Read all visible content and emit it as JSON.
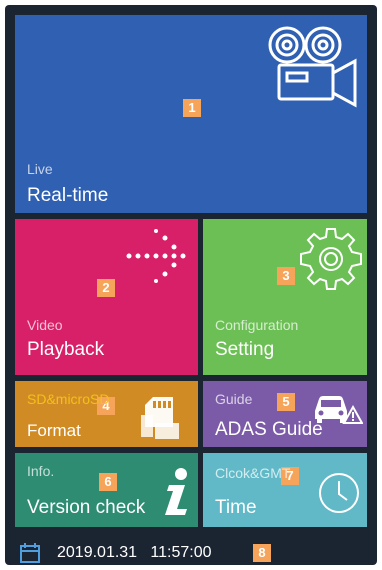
{
  "tiles": {
    "live": {
      "number": "1",
      "subtitle": "Live",
      "title": "Real-time",
      "icon": "video-camera-icon",
      "color": "#3060b2"
    },
    "playback": {
      "number": "2",
      "subtitle": "Video",
      "title": "Playback",
      "icon": "dotted-arrow-icon",
      "color": "#d72068"
    },
    "setting": {
      "number": "3",
      "subtitle": "Configuration",
      "title": "Setting",
      "icon": "gear-icon",
      "color": "#6cbf55"
    },
    "format": {
      "number": "4",
      "subtitle": "SD&microSD",
      "title": "Format",
      "icon": "sd-card-icon",
      "color": "#d18b24"
    },
    "adas": {
      "number": "5",
      "subtitle": "Guide",
      "title": "ADAS Guide",
      "icon": "car-warning-icon",
      "color": "#7b5ba8"
    },
    "version": {
      "number": "6",
      "subtitle": "Info.",
      "title": "Version check",
      "icon": "info-icon",
      "color": "#2e8c73"
    },
    "time": {
      "number": "7",
      "subtitle": "Clcok&GMT",
      "title": "Time",
      "icon": "clock-icon",
      "color": "#61b9c8"
    }
  },
  "status": {
    "datetime": "2019.01.31   11:57:00",
    "number": "8",
    "icon": "calendar-icon"
  }
}
